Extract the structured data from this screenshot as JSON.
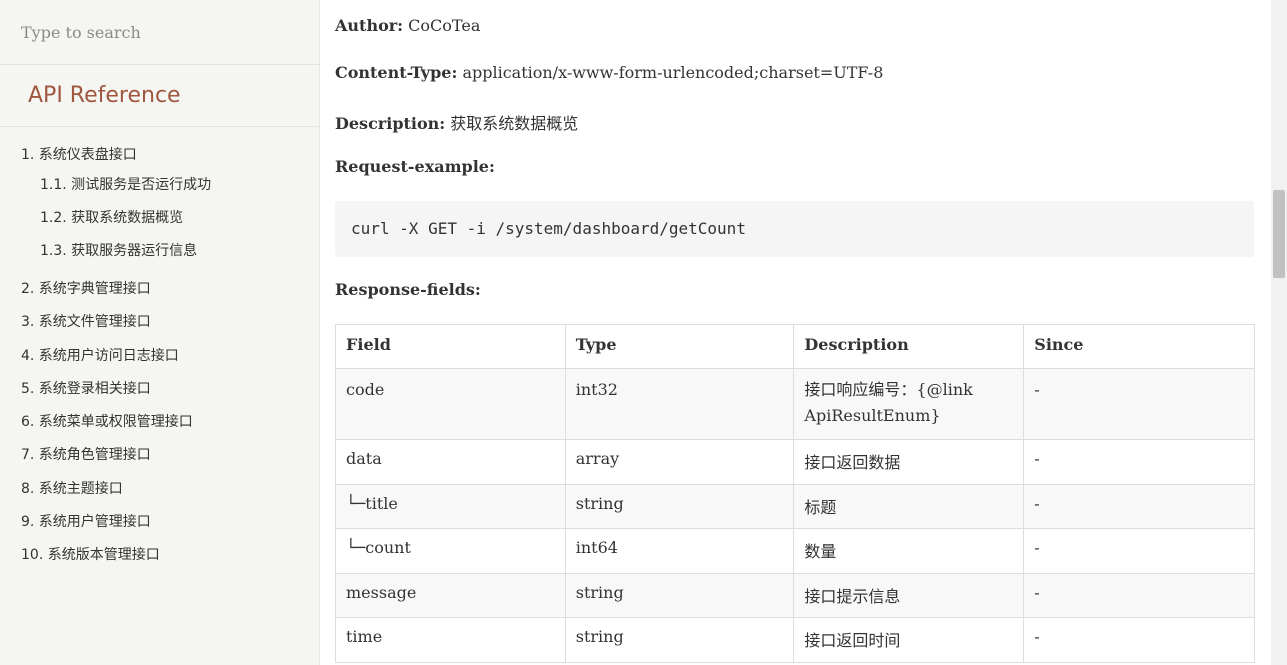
{
  "search": {
    "placeholder": "Type to search"
  },
  "toc": {
    "title": "API Reference",
    "items": [
      {
        "label": "1. 系统仪表盘接口",
        "level": 1
      },
      {
        "label": "1.1. 测试服务是否运行成功",
        "level": 2
      },
      {
        "label": "1.2. 获取系统数据概览",
        "level": 2
      },
      {
        "label": "1.3. 获取服务器运行信息",
        "level": 2
      },
      {
        "label": "2. 系统字典管理接口",
        "level": 1
      },
      {
        "label": "3. 系统文件管理接口",
        "level": 1
      },
      {
        "label": "4. 系统用户访问日志接口",
        "level": 1
      },
      {
        "label": "5. 系统登录相关接口",
        "level": 1
      },
      {
        "label": "6. 系统菜单或权限管理接口",
        "level": 1
      },
      {
        "label": "7. 系统角色管理接口",
        "level": 1
      },
      {
        "label": "8. 系统主题接口",
        "level": 1
      },
      {
        "label": "9. 系统用户管理接口",
        "level": 1
      },
      {
        "label": "10. 系统版本管理接口",
        "level": 1
      }
    ]
  },
  "doc": {
    "author_label": "Author:",
    "author_value": "CoCoTea",
    "content_type_label": "Content-Type:",
    "content_type_value": "application/x-www-form-urlencoded;charset=UTF-8",
    "description_label": "Description:",
    "description_value": "获取系统数据概览",
    "request_example_label": "Request-example:",
    "request_example_code": "curl -X GET -i /system/dashboard/getCount",
    "response_fields_label": "Response-fields:"
  },
  "table": {
    "headers": [
      "Field",
      "Type",
      "Description",
      "Since"
    ],
    "rows": [
      [
        "code",
        "int32",
        "接口响应编号：{@link ApiResultEnum}",
        "-"
      ],
      [
        "data",
        "array",
        "接口返回数据",
        "-"
      ],
      [
        "└─title",
        "string",
        "标题",
        "-"
      ],
      [
        "└─count",
        "int64",
        "数量",
        "-"
      ],
      [
        "message",
        "string",
        "接口提示信息",
        "-"
      ],
      [
        "time",
        "string",
        "接口返回时间",
        "-"
      ]
    ]
  }
}
